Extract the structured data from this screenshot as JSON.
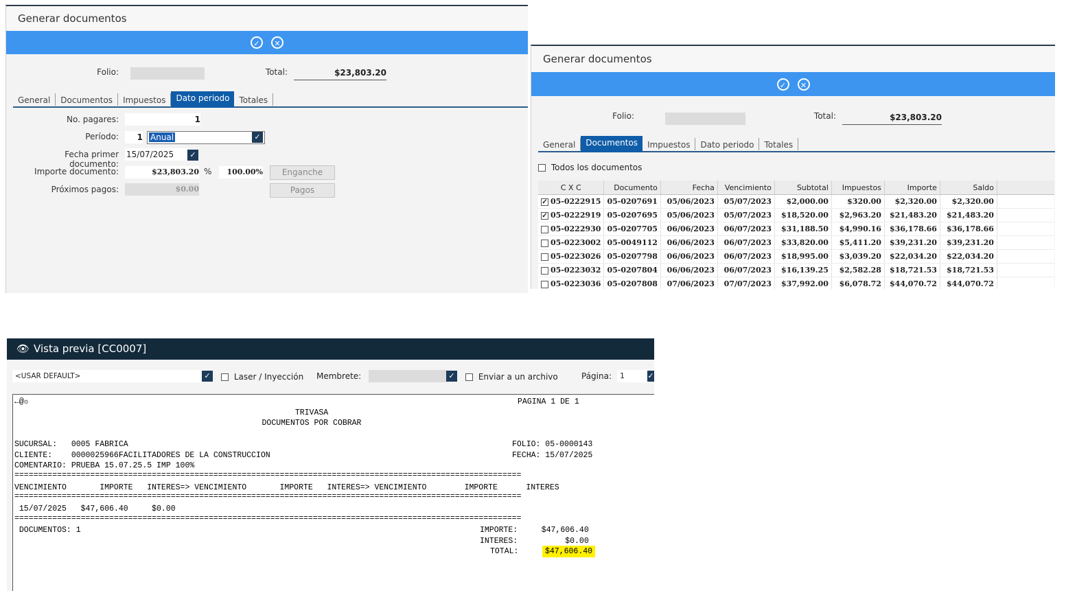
{
  "win1": {
    "title": "Generar documentos",
    "folio_label": "Folio:",
    "total_label": "Total:",
    "total_value": "$23,803.20",
    "tabs": [
      {
        "label": "General",
        "active": false
      },
      {
        "label": "Documentos",
        "active": false
      },
      {
        "label": "Impuestos",
        "active": false
      },
      {
        "label": "Dato periodo",
        "active": true
      },
      {
        "label": "Totales",
        "active": false
      }
    ],
    "no_pagares_label": "No. pagares:",
    "no_pagares_value": "1",
    "periodo_label": "Período:",
    "periodo_num": "1",
    "periodo_value": "Anual",
    "fecha_label": "Fecha primer documento:",
    "fecha_value": "15/07/2025",
    "importe_label": "Importe documento:",
    "importe_value": "$23,803.20",
    "pct_symbol": "%",
    "pct_value": "100.00%",
    "enganche_label": "Enganche",
    "proximos_label": "Próximos pagos:",
    "proximos_value": "$0.00",
    "pagos_label": "Pagos"
  },
  "win2": {
    "title": "Generar documentos",
    "folio_label": "Folio:",
    "total_label": "Total:",
    "total_value": "$23,803.20",
    "tabs": [
      {
        "label": "General",
        "active": false
      },
      {
        "label": "Documentos",
        "active": true
      },
      {
        "label": "Impuestos",
        "active": false
      },
      {
        "label": "Dato periodo",
        "active": false
      },
      {
        "label": "Totales",
        "active": false
      }
    ],
    "todos_label": "Todos los documentos",
    "columns": [
      "C X C",
      "Documento",
      "Fecha",
      "Vencimiento",
      "Subtotal",
      "Impuestos",
      "Importe",
      "Saldo"
    ],
    "rows": [
      {
        "checked": true,
        "cells": [
          "05-0222915",
          "05-0207691",
          "05/06/2023",
          "05/07/2023",
          "$2,000.00",
          "$320.00",
          "$2,320.00",
          "$2,320.00"
        ]
      },
      {
        "checked": true,
        "cells": [
          "05-0222919",
          "05-0207695",
          "05/06/2023",
          "05/07/2023",
          "$18,520.00",
          "$2,963.20",
          "$21,483.20",
          "$21,483.20"
        ]
      },
      {
        "checked": false,
        "cells": [
          "05-0222930",
          "05-0207705",
          "06/06/2023",
          "06/07/2023",
          "$31,188.50",
          "$4,990.16",
          "$36,178.66",
          "$36,178.66"
        ]
      },
      {
        "checked": false,
        "cells": [
          "05-0223002",
          "05-0049112",
          "06/06/2023",
          "06/07/2023",
          "$33,820.00",
          "$5,411.20",
          "$39,231.20",
          "$39,231.20"
        ]
      },
      {
        "checked": false,
        "cells": [
          "05-0223026",
          "05-0207798",
          "06/06/2023",
          "06/07/2023",
          "$18,995.00",
          "$3,039.20",
          "$22,034.20",
          "$22,034.20"
        ]
      },
      {
        "checked": false,
        "cells": [
          "05-0223032",
          "05-0207804",
          "06/06/2023",
          "06/07/2023",
          "$16,139.25",
          "$2,582.28",
          "$18,721.53",
          "$18,721.53"
        ]
      },
      {
        "checked": false,
        "cells": [
          "05-0223036",
          "05-0207808",
          "07/06/2023",
          "07/07/2023",
          "$37,992.00",
          "$6,078.72",
          "$44,070.72",
          "$44,070.72"
        ]
      }
    ]
  },
  "win3": {
    "title": "Vista previa [CC0007]",
    "printer_value": "<USAR DEFAULT>",
    "laser_label": "Laser / Inyección",
    "membrete_label": "Membrete:",
    "enviar_label": "Enviar a un archivo",
    "pagina_label": "Página:",
    "pagina_value": "1",
    "report": {
      "glyph": "←@☼",
      "pagina": "PAGINA 1 DE 1",
      "company": "TRIVASA",
      "subtitle": "DOCUMENTOS POR COBRAR",
      "sucursal": "SUCURSAL:   0005 FABRICA",
      "folio": "FOLIO: 05-0000143",
      "cliente": "CLIENTE:    0000025966FACILITADORES DE LA CONSTRUCCION",
      "fecha": "FECHA: 15/07/2025",
      "comentario": "COMENTARIO: PRUEBA 15.07.25.5 IMP 100%",
      "separator": "===========================================================================================================",
      "header": "VENCIMIENTO       IMPORTE   INTERES=> VENCIMIENTO       IMPORTE   INTERES=> VENCIMIENTO        IMPORTE      INTERES",
      "line1": " 15/07/2025   $47,606.40     $0.00",
      "documentos": " DOCUMENTOS: 1",
      "importe_line": "IMPORTE:     $47,606.40",
      "interes_line": "INTERES:          $0.00",
      "total_label": "TOTAL:",
      "total_value": "$47,606.40"
    }
  },
  "colors": {
    "accent_blue": "#3d95f0",
    "tab_active": "#0f5da8",
    "dark_title": "#132a3b",
    "highlight": "#fff000"
  }
}
